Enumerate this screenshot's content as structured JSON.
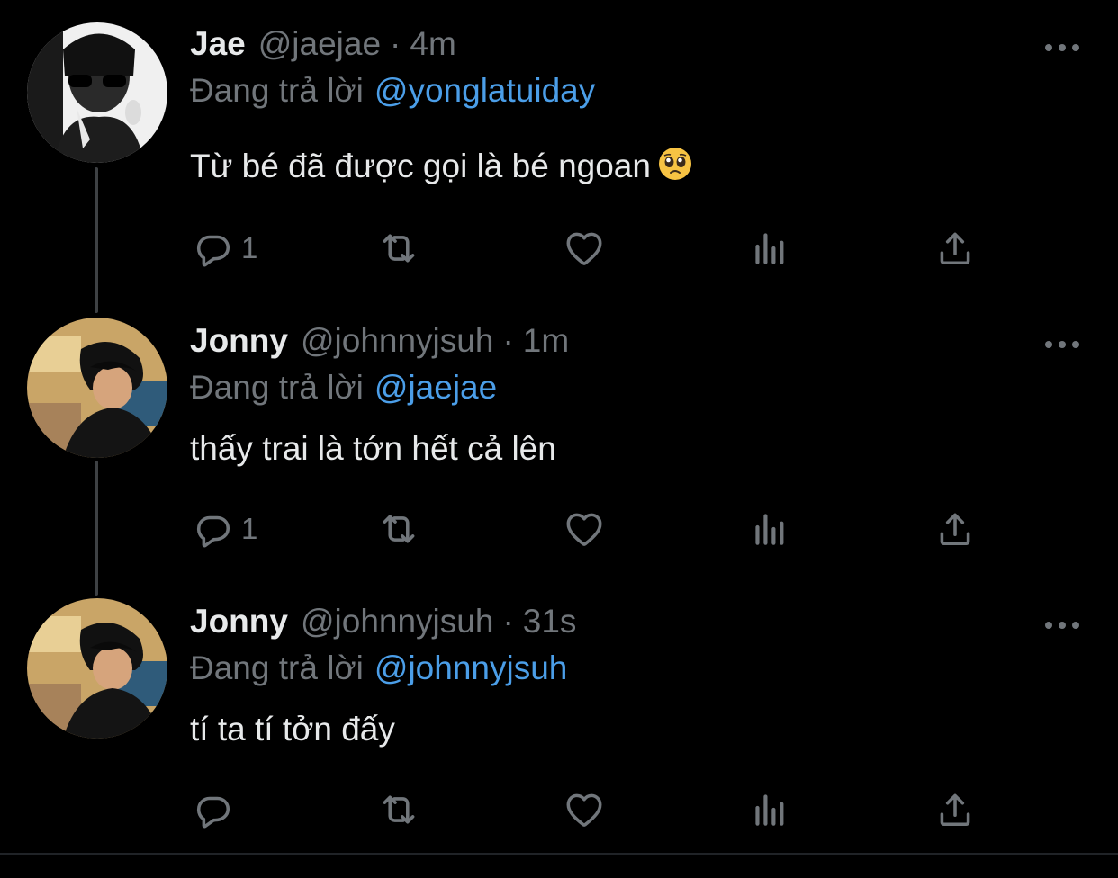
{
  "colors": {
    "background": "#000000",
    "text_primary": "#e7e9ea",
    "text_secondary": "#71767b",
    "accent": "#4b9ee8"
  },
  "tweets": [
    {
      "name": "Jae",
      "handle": "@jaejae",
      "separator": "·",
      "time": "4m",
      "replying_label": "Đang trả lời",
      "replying_to": "@yonglatuiday",
      "text": "Từ bé đã được gọi là bé ngoan",
      "emoji": "pleading-face-emoji",
      "reply_count": "1"
    },
    {
      "name": "Jonny",
      "handle": "@johnnyjsuh",
      "separator": "·",
      "time": "1m",
      "replying_label": "Đang trả lời",
      "replying_to": "@jaejae",
      "text": "thấy trai là tớn hết cả lên",
      "reply_count": "1"
    },
    {
      "name": "Jonny",
      "handle": "@johnnyjsuh",
      "separator": "·",
      "time": "31s",
      "replying_label": "Đang trả lời",
      "replying_to": "@johnnyjsuh",
      "text": "tí ta tí tởn đấy",
      "reply_count": ""
    }
  ],
  "icons": [
    "more-icon",
    "reply-icon",
    "retweet-icon",
    "like-icon",
    "analytics-icon",
    "share-icon"
  ]
}
